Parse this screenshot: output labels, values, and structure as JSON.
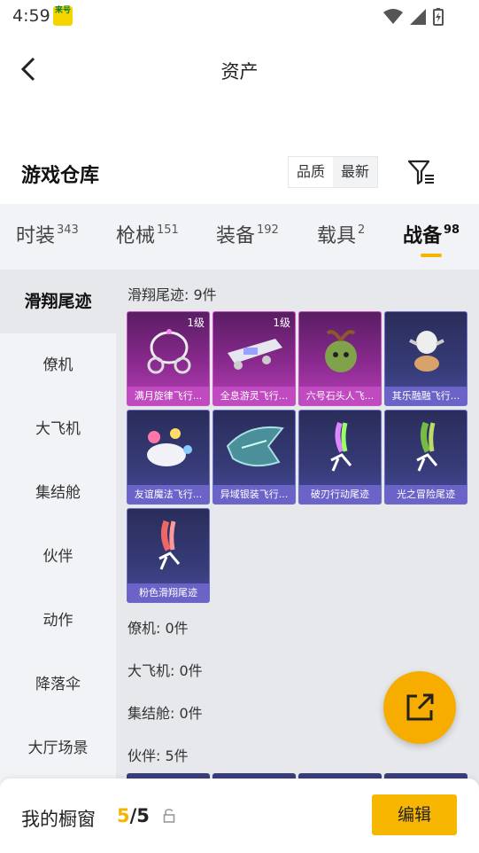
{
  "status_bar": {
    "time": "4:59",
    "badge_text": "来号"
  },
  "header": {
    "title": "资产",
    "back_icon": "chevron-left-icon"
  },
  "warehouse": {
    "title": "游戏仓库",
    "sort_options": [
      "品质",
      "最新"
    ],
    "filter_icon": "filter-icon"
  },
  "tabs": [
    {
      "label": "时装",
      "count": "343"
    },
    {
      "label": "枪械",
      "count": "151"
    },
    {
      "label": "装备",
      "count": "192"
    },
    {
      "label": "载具",
      "count": "2"
    },
    {
      "label": "战备",
      "count": "98"
    }
  ],
  "sidebar": {
    "items": [
      "滑翔尾迹",
      "僚机",
      "大飞机",
      "集结舱",
      "伙伴",
      "动作",
      "降落伞",
      "大厅场景"
    ]
  },
  "sections": {
    "glide": {
      "label": "滑翔尾迹:",
      "count": "9件"
    },
    "wingman": {
      "label": "僚机:",
      "count": "0件"
    },
    "plane": {
      "label": "大飞机:",
      "count": "0件"
    },
    "pod": {
      "label": "集结舱:",
      "count": "0件"
    },
    "partner": {
      "label": "伙伴:",
      "count": "5件"
    }
  },
  "items": [
    {
      "name": "满月旋律飞行...",
      "level": "1级",
      "rarity": "pink"
    },
    {
      "name": "全息游灵飞行...",
      "level": "1级",
      "rarity": "pink"
    },
    {
      "name": "六号石头人飞...",
      "level": "",
      "rarity": "pink"
    },
    {
      "name": "其乐融融飞行...",
      "level": "",
      "rarity": "blue"
    },
    {
      "name": "友谊魔法飞行...",
      "level": "",
      "rarity": "blue"
    },
    {
      "name": "异域银装飞行...",
      "level": "",
      "rarity": "blue"
    },
    {
      "name": "破刃行动尾迹",
      "level": "",
      "rarity": "blue"
    },
    {
      "name": "光之冒险尾迹",
      "level": "",
      "rarity": "blue"
    },
    {
      "name": "粉色滑翔尾迹",
      "level": "",
      "rarity": "blue"
    }
  ],
  "showcase": {
    "label": "我的橱窗",
    "current": "5",
    "sep": "/",
    "total": "5",
    "edit_label": "编辑"
  },
  "colors": {
    "accent": "#f7b600",
    "rare_pink": "#c04ac0",
    "rare_blue": "#6b63c8"
  }
}
